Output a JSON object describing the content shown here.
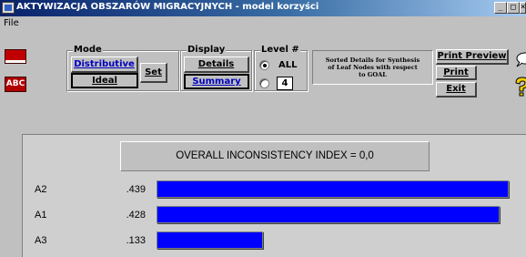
{
  "window": {
    "title": "AKTYWIZACJA OBSZARÓW MIGRACYJNYCH - model korzyści",
    "controls": {
      "minimize": "_",
      "maximize": "□",
      "close": "×"
    }
  },
  "menu": {
    "file": "File"
  },
  "tools": {
    "abc_label": "ABC"
  },
  "mode": {
    "label": "Mode",
    "distributive": "Distributive",
    "ideal": "Ideal",
    "set": "Set"
  },
  "display": {
    "label": "Display",
    "details": "Details",
    "summary": "Summary"
  },
  "level": {
    "label": "Level #",
    "all": "ALL",
    "value": "4",
    "selected": "ALL"
  },
  "info": {
    "line1": "Sorted Details for Synthesis",
    "line2": "of Leaf Nodes with respect",
    "line3": "to GOAL"
  },
  "actions": {
    "print_preview": "Print Preview",
    "print": "Print",
    "exit": "Exit"
  },
  "results": {
    "inconsistency": "OVERALL INCONSISTENCY INDEX =  0,0",
    "bar_color": "#0000ff",
    "rows": [
      {
        "label": "A2",
        "value": ".439",
        "fraction": 0.439
      },
      {
        "label": "A1",
        "value": ".428",
        "fraction": 0.428
      },
      {
        "label": "A3",
        "value": ".133",
        "fraction": 0.133
      }
    ]
  }
}
